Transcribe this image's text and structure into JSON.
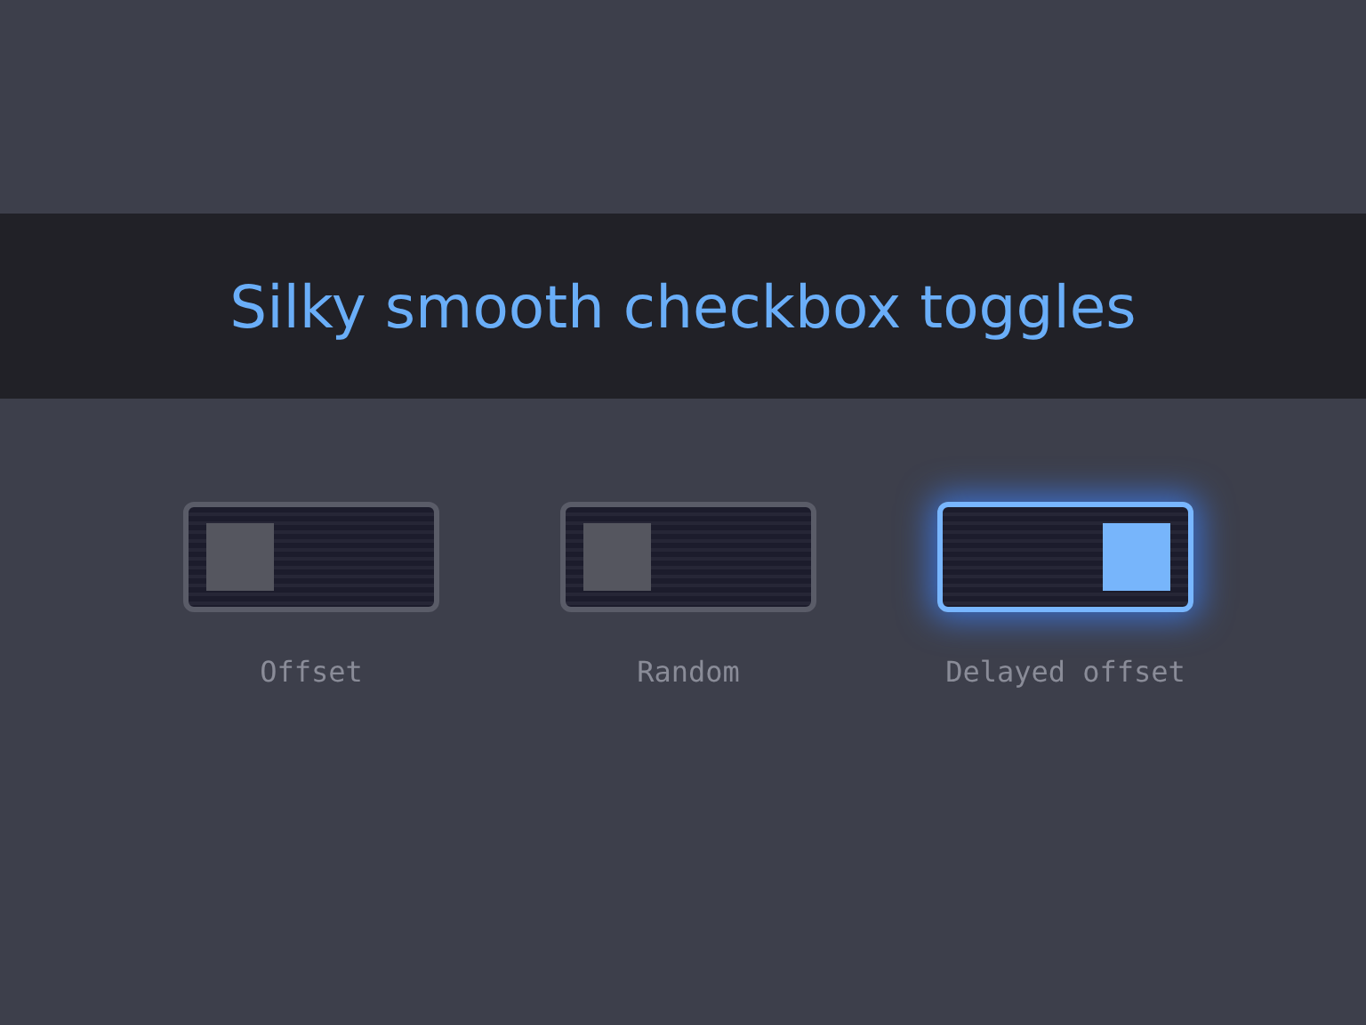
{
  "title": "Silky smooth checkbox toggles",
  "toggles": [
    {
      "label": "Offset",
      "checked": false
    },
    {
      "label": "Random",
      "checked": false
    },
    {
      "label": "Delayed offset",
      "checked": true
    }
  ]
}
